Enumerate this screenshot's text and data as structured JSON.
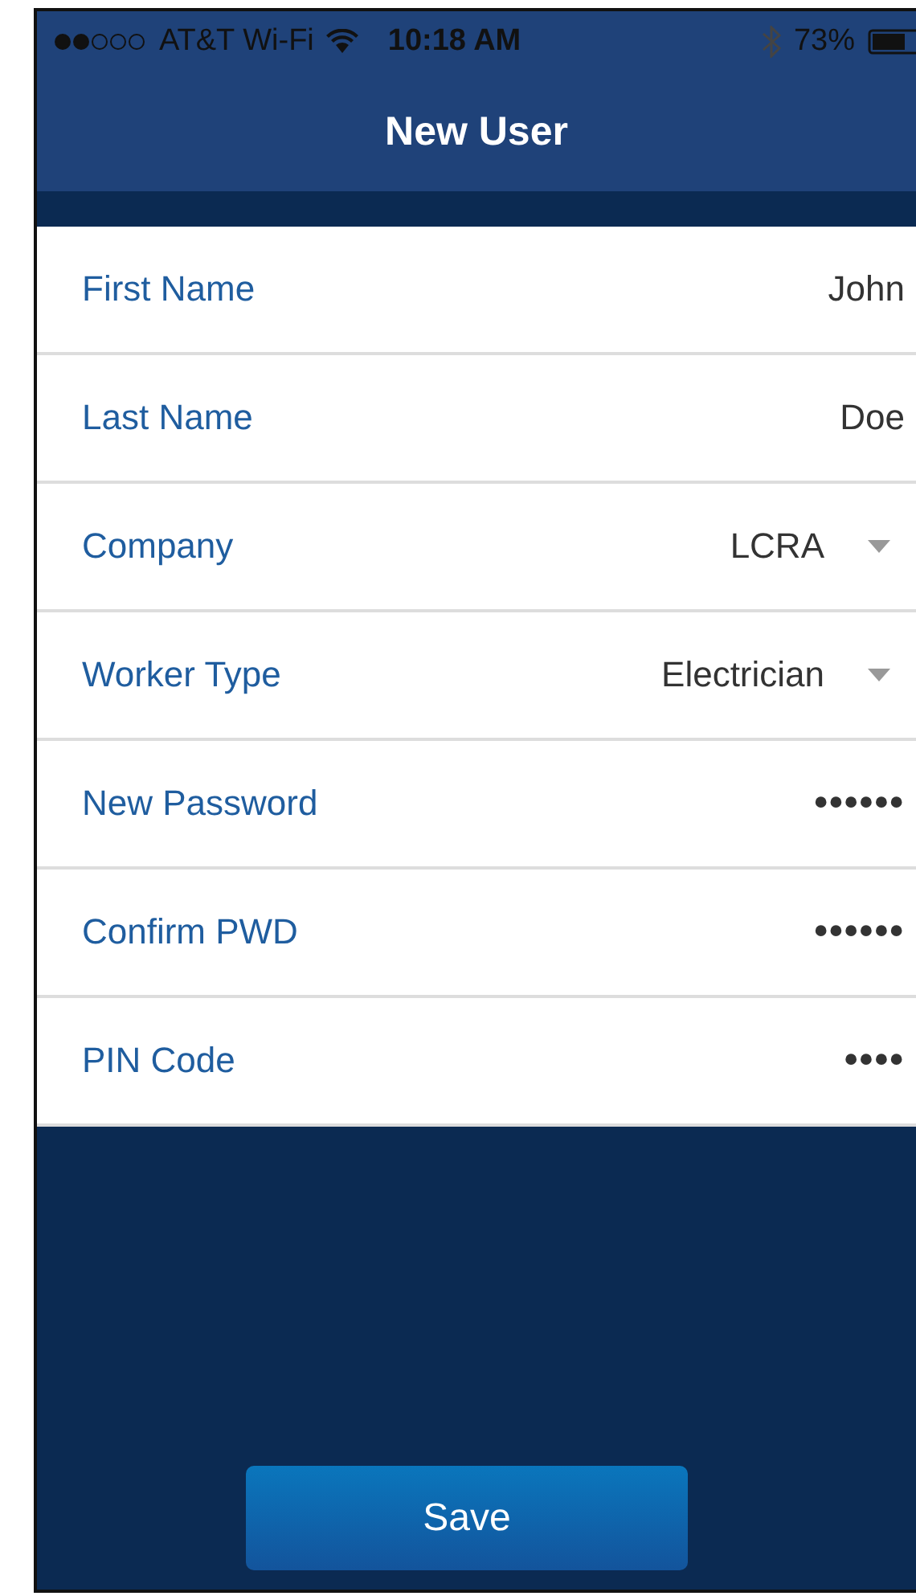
{
  "status_bar": {
    "carrier": "AT&T Wi-Fi",
    "time": "10:18 AM",
    "battery": "73%"
  },
  "nav": {
    "title": "New User"
  },
  "fields": [
    {
      "kind": "text",
      "label": "First Name",
      "value": "John"
    },
    {
      "kind": "text",
      "label": "Last Name",
      "value": "Doe"
    },
    {
      "kind": "select",
      "label": "Company",
      "value": "LCRA"
    },
    {
      "kind": "select",
      "label": "Worker Type",
      "value": "Electrician"
    },
    {
      "kind": "secret",
      "label": "New Password",
      "value": "••••••"
    },
    {
      "kind": "secret",
      "label": "Confirm PWD",
      "value": "••••••"
    },
    {
      "kind": "secret",
      "label": "PIN Code",
      "value": "••••"
    }
  ],
  "save_button": "Save"
}
